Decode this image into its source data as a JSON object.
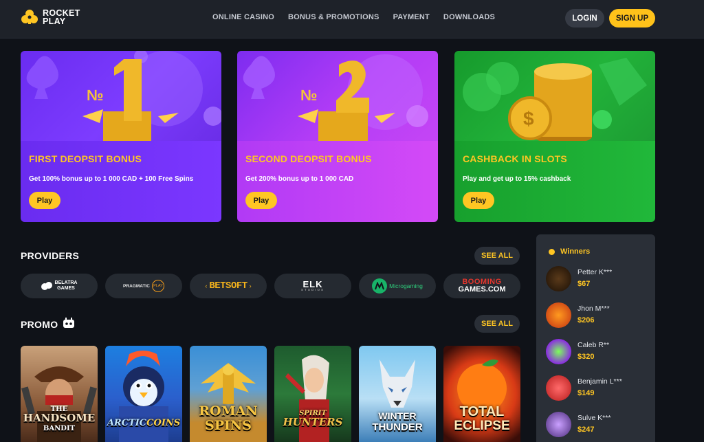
{
  "header": {
    "logo_line1": "ROCKET",
    "logo_line2": "PLAY",
    "nav": [
      "ONLINE CASINO",
      "BONUS & PROMOTIONS",
      "PAYMENT",
      "DOWNLOADS"
    ],
    "login_label": "LOGIN",
    "signup_label": "SIGN UP"
  },
  "promos": [
    {
      "title": "FIRST DEOPSIT BONUS",
      "desc": "Get 100% bonus up to 1 000 CAD + 100 Free Spins",
      "play": "Play",
      "badge": "№1"
    },
    {
      "title": "SECOND DEOPSIT BONUS",
      "desc": "Get 200% bonus up to 1 000 CAD",
      "play": "Play",
      "badge": "№2"
    },
    {
      "title": "CASHBACK IN SLOTS",
      "desc": "Play and get up to 15% cashback",
      "play": "Play"
    }
  ],
  "providers_section": {
    "title": "PROVIDERS",
    "see_all": "SEE ALL",
    "items": [
      {
        "line1": "BELATRA",
        "line2": "GAMES"
      },
      {
        "line1": "PRAGMATIC",
        "line2": "PLAY"
      },
      {
        "line1": "BETSOFT"
      },
      {
        "line1": "ELK",
        "line2": "STUDIOS"
      },
      {
        "line1": "Microgaming"
      },
      {
        "line1": "BOOMING",
        "line2": "GAMES.COM"
      }
    ]
  },
  "promo_section": {
    "title": "PROMO",
    "see_all": "SEE ALL",
    "games": [
      {
        "line1": "THE",
        "line2": "HANDSOME",
        "line3": "BANDIT"
      },
      {
        "line1": "ARCTIC",
        "line2": "COINS",
        "line3": ""
      },
      {
        "line1": "ROMAN",
        "line2": "SPINS",
        "line3": ""
      },
      {
        "line1": "SPIRIT",
        "line2": "HUNTERS",
        "line3": ""
      },
      {
        "line1": "WINTER",
        "line2": "THUNDER",
        "line3": ""
      },
      {
        "line1": "TOTAL",
        "line2": "ECLIPSE",
        "line3": ""
      }
    ]
  },
  "winners": {
    "title": "Winners",
    "items": [
      {
        "name": "Petter K***",
        "amount": "$67"
      },
      {
        "name": "Jhon M***",
        "amount": "$206"
      },
      {
        "name": "Caleb R**",
        "amount": "$320"
      },
      {
        "name": "Benjamin L***",
        "amount": "$149"
      },
      {
        "name": "Sulve K***",
        "amount": "$247"
      }
    ]
  },
  "colors": {
    "accent": "#ffc623",
    "background": "#0f1218",
    "panel": "#2a2f37"
  }
}
